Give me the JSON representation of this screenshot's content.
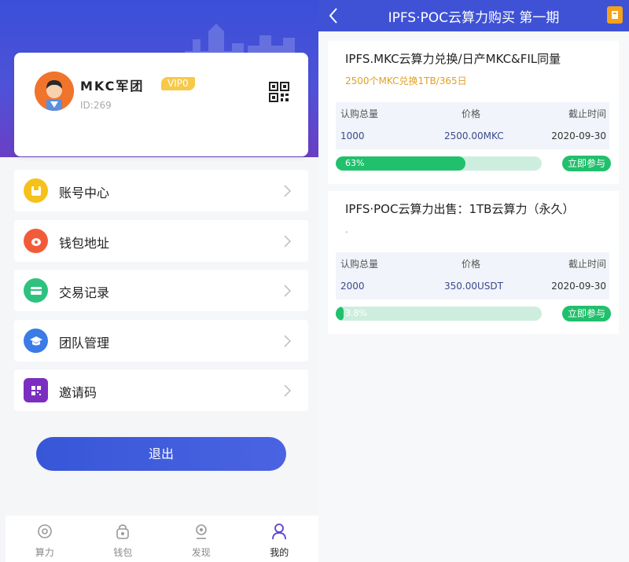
{
  "profile": {
    "username": "MKC军团",
    "vip_label": "VIP0",
    "user_id": "ID:269"
  },
  "menu": [
    {
      "label": "账号中心",
      "icon": "account-icon",
      "color": "#f5c21b"
    },
    {
      "label": "钱包地址",
      "icon": "wallet-icon",
      "color": "#f25b3a"
    },
    {
      "label": "交易记录",
      "icon": "card-icon",
      "color": "#2ec27e"
    },
    {
      "label": "团队管理",
      "icon": "graduation-cap-icon",
      "color": "#3a7be8"
    },
    {
      "label": "邀请码",
      "icon": "qrcode-icon",
      "color": "#7b2fc1"
    }
  ],
  "logout_label": "退出",
  "tabs": [
    {
      "label": "算力",
      "icon": "hashrate-icon"
    },
    {
      "label": "钱包",
      "icon": "wallet-bag-icon"
    },
    {
      "label": "发现",
      "icon": "discover-icon"
    },
    {
      "label": "我的",
      "icon": "user-icon"
    }
  ],
  "purchase": {
    "title": "IPFS·POC云算力购买 第一期",
    "products": [
      {
        "title": "IPFS.MKC云算力兑换/日产MKC&FIL同量",
        "subtitle": "2500个MKC兑换1TB/365日",
        "headers": [
          "认购总量",
          "价格",
          "截止时间"
        ],
        "total": "1000",
        "price": "2500.00MKC",
        "deadline": "2020-09-30",
        "progress_label": "63%",
        "progress": 0.63,
        "join_label": "立即参与"
      },
      {
        "title": "IPFS·POC云算力出售：1TB云算力（永久）",
        "subtitle": ".",
        "headers": [
          "认购总量",
          "价格",
          "截止时间"
        ],
        "total": "2000",
        "price": "350.00USDT",
        "deadline": "2020-09-30",
        "progress_label": "3.8%",
        "progress": 0.038,
        "join_label": "立即参与"
      }
    ]
  },
  "colors": {
    "brand_blue": "#3f52d6",
    "progress_green": "#21c06c",
    "accent_orange": "#e2a024"
  }
}
